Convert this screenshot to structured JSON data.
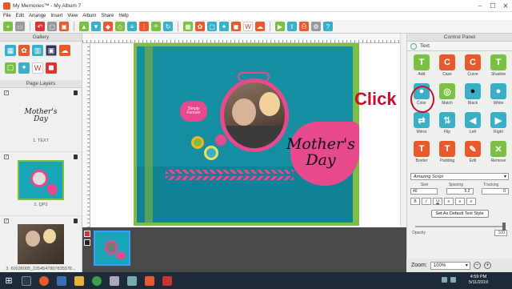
{
  "window": {
    "title": "My Memories™ - My Album 7"
  },
  "menu": [
    "File",
    "Edit",
    "Arrange",
    "Insert",
    "View",
    "Album",
    "Share",
    "Help"
  ],
  "gallery": {
    "header": "Gallery"
  },
  "page_layers": {
    "header": "Page Layers",
    "items": [
      {
        "caption": "1. TEXT",
        "thumb_text": "Mother's Day"
      },
      {
        "caption": "2. QP2"
      },
      {
        "caption": "3. 60036005_2254547807835578..."
      }
    ]
  },
  "canvas": {
    "title_line1": "Mother's",
    "title_line2": "Day",
    "tag_text": "Simply Forever"
  },
  "annotation": {
    "text": "Click"
  },
  "control_panel": {
    "header": "Control Panel",
    "section": "Text",
    "buttons": [
      {
        "label": "Add",
        "icon": "text-add-icon",
        "color": "#7bc043"
      },
      {
        "label": "Case",
        "icon": "case-icon",
        "color": "#e8592b"
      },
      {
        "label": "Curve",
        "icon": "curve-icon",
        "color": "#e8592b"
      },
      {
        "label": "Shadow",
        "icon": "shadow-icon",
        "color": "#7bc043"
      },
      {
        "label": "Color",
        "icon": "color-drop-icon",
        "color": "#3ab0c8"
      },
      {
        "label": "Match",
        "icon": "match-icon",
        "color": "#7bc043"
      },
      {
        "label": "Black",
        "icon": "black-drop-icon",
        "color": "#3ab0c8"
      },
      {
        "label": "White",
        "icon": "white-drop-icon",
        "color": "#3ab0c8"
      },
      {
        "label": "Mirror",
        "icon": "mirror-icon",
        "color": "#3ab0c8"
      },
      {
        "label": "Flip",
        "icon": "flip-icon",
        "color": "#3ab0c8"
      },
      {
        "label": "Left",
        "icon": "rotate-left-icon",
        "color": "#3ab0c8"
      },
      {
        "label": "Right",
        "icon": "rotate-right-icon",
        "color": "#3ab0c8"
      },
      {
        "label": "Border",
        "icon": "border-icon",
        "color": "#e8592b"
      },
      {
        "label": "Padding",
        "icon": "padding-icon",
        "color": "#e8592b"
      },
      {
        "label": "Edit",
        "icon": "edit-icon",
        "color": "#e8592b"
      },
      {
        "label": "Remove",
        "icon": "remove-icon",
        "color": "#7bc043"
      }
    ],
    "font": "Amazing Script",
    "size_label": "Size",
    "spacing_label": "Spacing",
    "tracking_label": "Tracking",
    "size_value": "40",
    "spacing_value": "5.2",
    "tracking_value": "0",
    "default_button": "Set As Default Text Style",
    "opacity_label": "Opacity",
    "opacity_value": "100"
  },
  "zoom": {
    "label": "Zoom:",
    "value": "100%"
  },
  "taskbar": {
    "time": "4:59 PM",
    "date": "5/11/2019"
  }
}
